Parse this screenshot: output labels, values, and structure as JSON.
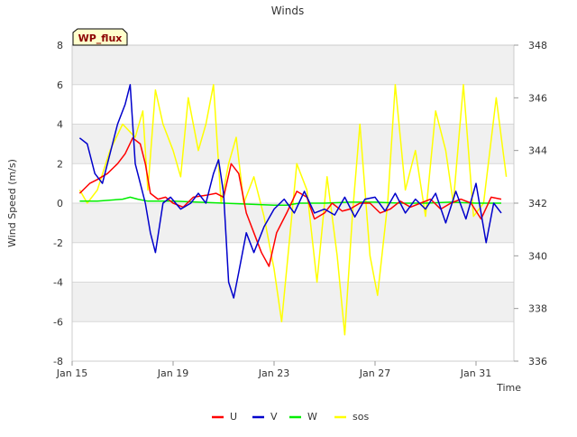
{
  "chart_data": {
    "type": "line",
    "title": "Winds",
    "badge": "WP_flux",
    "xlabel": "Time",
    "ylabel": "Wind Speed (m/s)",
    "x_range_days": [
      0,
      17.5
    ],
    "xticks": [
      {
        "x": 0,
        "label": "Jan 15"
      },
      {
        "x": 4,
        "label": "Jan 19"
      },
      {
        "x": 8,
        "label": "Jan 23"
      },
      {
        "x": 12,
        "label": "Jan 27"
      },
      {
        "x": 16,
        "label": "Jan 31"
      }
    ],
    "ylim": [
      -8,
      8
    ],
    "yticks": [
      -8,
      -6,
      -4,
      -2,
      0,
      2,
      4,
      6,
      8
    ],
    "y2lim": [
      336,
      348
    ],
    "y2ticks": [
      336,
      338,
      340,
      342,
      344,
      346,
      348
    ],
    "grid": true,
    "legend": "bottom-center",
    "colors": {
      "U": "#ff0000",
      "V": "#0000cc",
      "W": "#00ee00",
      "sos": "#ffff00"
    },
    "series": [
      {
        "name": "U",
        "axis": "left",
        "x": [
          0.3,
          0.7,
          1.0,
          1.4,
          1.8,
          2.1,
          2.4,
          2.7,
          2.9,
          3.1,
          3.4,
          3.7,
          4.0,
          4.4,
          4.8,
          5.3,
          5.7,
          6.0,
          6.3,
          6.6,
          6.9,
          7.2,
          7.5,
          7.8,
          8.1,
          8.5,
          8.9,
          9.3,
          9.6,
          10.0,
          10.3,
          10.7,
          11.0,
          11.4,
          11.8,
          12.2,
          12.6,
          13.0,
          13.4,
          13.8,
          14.2,
          14.6,
          15.0,
          15.4,
          15.8,
          16.2,
          16.6,
          17.0
        ],
        "y": [
          0.5,
          1.0,
          1.2,
          1.5,
          2.0,
          2.5,
          3.3,
          3.0,
          2.0,
          0.5,
          0.2,
          0.3,
          0.0,
          -0.2,
          0.3,
          0.4,
          0.5,
          0.3,
          2.0,
          1.5,
          -0.5,
          -1.5,
          -2.5,
          -3.2,
          -1.5,
          -0.5,
          0.6,
          0.3,
          -0.8,
          -0.5,
          0.0,
          -0.4,
          -0.3,
          0.0,
          0.0,
          -0.5,
          -0.3,
          0.1,
          -0.2,
          0.0,
          0.2,
          -0.3,
          0.0,
          0.2,
          0.0,
          -0.8,
          0.3,
          0.2
        ]
      },
      {
        "name": "V",
        "axis": "left",
        "x": [
          0.3,
          0.6,
          0.9,
          1.2,
          1.5,
          1.8,
          2.1,
          2.3,
          2.5,
          2.7,
          2.9,
          3.1,
          3.3,
          3.6,
          3.9,
          4.3,
          4.7,
          5.0,
          5.3,
          5.6,
          5.8,
          6.0,
          6.2,
          6.4,
          6.6,
          6.9,
          7.2,
          7.6,
          8.0,
          8.4,
          8.8,
          9.2,
          9.6,
          10.0,
          10.4,
          10.8,
          11.2,
          11.6,
          12.0,
          12.4,
          12.8,
          13.2,
          13.6,
          14.0,
          14.4,
          14.8,
          15.2,
          15.6,
          16.0,
          16.4,
          16.7,
          17.0
        ],
        "y": [
          3.3,
          3.0,
          1.5,
          1.0,
          2.5,
          4.0,
          5.0,
          6.0,
          2.0,
          1.0,
          0.0,
          -1.5,
          -2.5,
          0.0,
          0.3,
          -0.3,
          0.0,
          0.5,
          0.0,
          1.5,
          2.2,
          0.5,
          -4.0,
          -4.8,
          -3.5,
          -1.5,
          -2.5,
          -1.2,
          -0.3,
          0.2,
          -0.5,
          0.6,
          -0.5,
          -0.3,
          -0.6,
          0.3,
          -0.7,
          0.2,
          0.3,
          -0.4,
          0.5,
          -0.5,
          0.2,
          -0.3,
          0.5,
          -1.0,
          0.6,
          -0.8,
          1.0,
          -2.0,
          0.0,
          -0.5
        ]
      },
      {
        "name": "W",
        "axis": "left",
        "x": [
          0.3,
          1.0,
          2.0,
          2.3,
          2.6,
          3.0,
          4.0,
          5.0,
          6.0,
          7.0,
          8.0,
          8.5,
          9.0,
          10.0,
          11.0,
          12.0,
          13.0,
          14.0,
          15.0,
          16.0,
          17.0
        ],
        "y": [
          0.1,
          0.1,
          0.2,
          0.3,
          0.2,
          0.1,
          0.1,
          0.05,
          0.0,
          -0.05,
          -0.1,
          -0.1,
          0.0,
          0.0,
          0.05,
          0.05,
          0.0,
          0.0,
          0.05,
          0.0,
          0.0
        ]
      },
      {
        "name": "sos",
        "axis": "right",
        "x": [
          0.3,
          0.6,
          1.0,
          1.5,
          2.0,
          2.5,
          2.8,
          3.0,
          3.3,
          3.6,
          4.0,
          4.3,
          4.6,
          5.0,
          5.3,
          5.6,
          5.9,
          6.2,
          6.5,
          6.8,
          7.2,
          7.6,
          8.0,
          8.3,
          8.6,
          8.9,
          9.3,
          9.7,
          10.1,
          10.5,
          10.8,
          11.1,
          11.4,
          11.8,
          12.1,
          12.5,
          12.8,
          13.2,
          13.6,
          14.0,
          14.4,
          14.8,
          15.1,
          15.5,
          15.9,
          16.3,
          16.8,
          17.2
        ],
        "y": [
          342.5,
          342.0,
          342.5,
          344.0,
          345.0,
          344.5,
          345.5,
          342.5,
          346.3,
          345.0,
          344.0,
          343.0,
          346.0,
          344.0,
          345.0,
          346.5,
          342.0,
          343.5,
          344.5,
          342.0,
          343.0,
          341.5,
          339.5,
          337.5,
          340.5,
          343.5,
          342.5,
          339.0,
          343.0,
          340.0,
          337.0,
          341.5,
          345.0,
          340.0,
          338.5,
          342.0,
          346.5,
          342.5,
          344.0,
          341.5,
          345.5,
          344.0,
          342.0,
          346.5,
          341.5,
          342.0,
          346.0,
          343.0
        ]
      }
    ]
  }
}
